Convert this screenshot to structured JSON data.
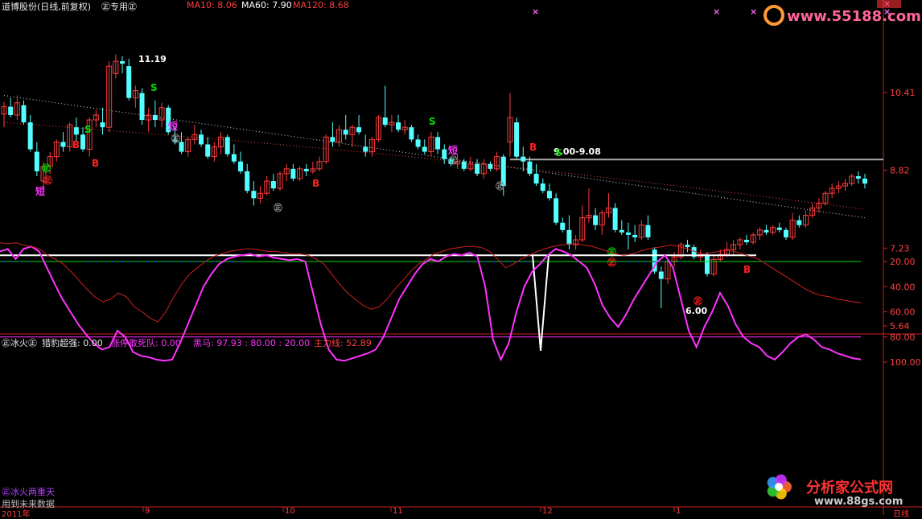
{
  "header": {
    "stock": "道博股份(日线,前复权)",
    "special": "㊣专用㊣",
    "ma10": "MA10: 8.06",
    "ma60": "MA60: 7.90",
    "ma120": "MA120: 8.68"
  },
  "indicator_header": {
    "name": "㊣冰火㊣",
    "leopard": "猎豹超强: 0.00",
    "zhangting": "涨停敢死队: 0.00",
    "heima": "黑马: 97.93 : 80.00 : 20.00",
    "zhuli": "主力线: 52.89"
  },
  "bottom_labels": {
    "title": "㊣冰火两重天",
    "note": "用到未来数据",
    "year": "2011年",
    "right": "日线"
  },
  "watermarks": {
    "top": "www.55188.com",
    "bottom_cn": "分析家公式网",
    "bottom_url": "www.88gs.com"
  },
  "colors": {
    "up": "#ff3c3c",
    "down": "#54ffff",
    "purple": "#b040ff",
    "magenta": "#ff33ff",
    "blue": "#1a1aff",
    "green": "#00dd00",
    "red": "#ff2020",
    "grid": "#8b0000",
    "axis": "#cc2222"
  },
  "chart_data": {
    "type": "candlestick",
    "title": "道博股份(日线,前复权)",
    "price_axis_ticks": [
      "10.41",
      "8.82",
      "7.23",
      "5.64"
    ],
    "price_range": [
      5.64,
      11.2
    ],
    "month_labels": [
      "9",
      "10",
      "11",
      "12",
      "1"
    ],
    "annotations": {
      "high_label": "11.19",
      "low_label": "6.00",
      "range_label": "9.00-9.08",
      "signal_B": "B",
      "signal_S": "S",
      "signal_short": "短",
      "signal_zheng": "㊣"
    },
    "candles": [
      {
        "o": 9.97,
        "h": 10.22,
        "l": 9.7,
        "c": 10.12
      },
      {
        "o": 10.12,
        "h": 10.3,
        "l": 9.9,
        "c": 9.95
      },
      {
        "o": 9.95,
        "h": 10.35,
        "l": 9.85,
        "c": 10.2
      },
      {
        "o": 10.15,
        "h": 10.25,
        "l": 9.75,
        "c": 9.8
      },
      {
        "o": 9.8,
        "h": 9.95,
        "l": 9.2,
        "c": 9.25
      },
      {
        "o": 9.2,
        "h": 9.4,
        "l": 8.7,
        "c": 8.8
      },
      {
        "o": 8.6,
        "h": 9.0,
        "l": 8.4,
        "c": 8.9
      },
      {
        "o": 8.9,
        "h": 9.2,
        "l": 8.75,
        "c": 9.1
      },
      {
        "o": 9.1,
        "h": 9.45,
        "l": 9.0,
        "c": 9.4
      },
      {
        "o": 9.4,
        "h": 9.6,
        "l": 9.2,
        "c": 9.3
      },
      {
        "o": 9.3,
        "h": 9.8,
        "l": 9.2,
        "c": 9.75
      },
      {
        "o": 9.7,
        "h": 9.9,
        "l": 9.4,
        "c": 9.55
      },
      {
        "o": 9.55,
        "h": 9.7,
        "l": 9.2,
        "c": 9.25
      },
      {
        "o": 9.25,
        "h": 9.9,
        "l": 9.1,
        "c": 9.85
      },
      {
        "o": 9.85,
        "h": 10.05,
        "l": 9.7,
        "c": 9.95
      },
      {
        "o": 9.8,
        "h": 10.1,
        "l": 9.55,
        "c": 9.7
      },
      {
        "o": 9.7,
        "h": 11.05,
        "l": 9.6,
        "c": 10.95
      },
      {
        "o": 10.8,
        "h": 11.19,
        "l": 10.7,
        "c": 11.05
      },
      {
        "o": 11.05,
        "h": 11.15,
        "l": 10.8,
        "c": 11.0
      },
      {
        "o": 10.95,
        "h": 11.1,
        "l": 10.25,
        "c": 10.3
      },
      {
        "o": 10.3,
        "h": 10.55,
        "l": 10.1,
        "c": 10.45
      },
      {
        "o": 10.4,
        "h": 10.5,
        "l": 9.75,
        "c": 9.85
      },
      {
        "o": 9.85,
        "h": 10.1,
        "l": 9.6,
        "c": 9.95
      },
      {
        "o": 9.95,
        "h": 10.25,
        "l": 9.7,
        "c": 9.85
      },
      {
        "o": 9.85,
        "h": 10.2,
        "l": 9.7,
        "c": 10.1
      },
      {
        "o": 10.1,
        "h": 10.15,
        "l": 9.55,
        "c": 9.6
      },
      {
        "o": 9.45,
        "h": 9.7,
        "l": 9.35,
        "c": 9.4
      },
      {
        "o": 9.4,
        "h": 9.6,
        "l": 9.15,
        "c": 9.2
      },
      {
        "o": 9.2,
        "h": 9.5,
        "l": 9.1,
        "c": 9.45
      },
      {
        "o": 9.45,
        "h": 9.75,
        "l": 9.35,
        "c": 9.55
      },
      {
        "o": 9.55,
        "h": 9.65,
        "l": 9.3,
        "c": 9.35
      },
      {
        "o": 9.35,
        "h": 9.5,
        "l": 9.05,
        "c": 9.1
      },
      {
        "o": 9.1,
        "h": 9.4,
        "l": 9.0,
        "c": 9.3
      },
      {
        "o": 9.3,
        "h": 9.6,
        "l": 9.15,
        "c": 9.5
      },
      {
        "o": 9.5,
        "h": 9.55,
        "l": 9.1,
        "c": 9.15
      },
      {
        "o": 9.15,
        "h": 9.35,
        "l": 8.95,
        "c": 9.0
      },
      {
        "o": 9.0,
        "h": 9.2,
        "l": 8.75,
        "c": 8.8
      },
      {
        "o": 8.8,
        "h": 8.95,
        "l": 8.35,
        "c": 8.4
      },
      {
        "o": 8.4,
        "h": 8.6,
        "l": 8.1,
        "c": 8.25
      },
      {
        "o": 8.25,
        "h": 8.5,
        "l": 8.15,
        "c": 8.35
      },
      {
        "o": 8.35,
        "h": 8.7,
        "l": 8.3,
        "c": 8.6
      },
      {
        "o": 8.6,
        "h": 8.75,
        "l": 8.4,
        "c": 8.45
      },
      {
        "o": 8.45,
        "h": 8.8,
        "l": 8.4,
        "c": 8.75
      },
      {
        "o": 8.75,
        "h": 8.95,
        "l": 8.6,
        "c": 8.85
      },
      {
        "o": 8.85,
        "h": 8.95,
        "l": 8.6,
        "c": 8.65
      },
      {
        "o": 8.65,
        "h": 8.9,
        "l": 8.6,
        "c": 8.85
      },
      {
        "o": 8.85,
        "h": 8.95,
        "l": 8.7,
        "c": 8.8
      },
      {
        "o": 8.8,
        "h": 9.0,
        "l": 8.75,
        "c": 8.85
      },
      {
        "o": 8.85,
        "h": 9.1,
        "l": 8.8,
        "c": 9.0
      },
      {
        "o": 9.0,
        "h": 9.55,
        "l": 8.95,
        "c": 9.5
      },
      {
        "o": 9.5,
        "h": 9.8,
        "l": 9.3,
        "c": 9.4
      },
      {
        "o": 9.4,
        "h": 9.75,
        "l": 9.3,
        "c": 9.65
      },
      {
        "o": 9.65,
        "h": 9.95,
        "l": 9.45,
        "c": 9.55
      },
      {
        "o": 9.55,
        "h": 9.75,
        "l": 9.3,
        "c": 9.7
      },
      {
        "o": 9.7,
        "h": 9.95,
        "l": 9.55,
        "c": 9.6
      },
      {
        "o": 9.3,
        "h": 9.55,
        "l": 9.1,
        "c": 9.2
      },
      {
        "o": 9.2,
        "h": 9.5,
        "l": 9.1,
        "c": 9.45
      },
      {
        "o": 9.45,
        "h": 9.95,
        "l": 9.4,
        "c": 9.9
      },
      {
        "o": 9.9,
        "h": 10.55,
        "l": 9.7,
        "c": 9.75
      },
      {
        "o": 9.75,
        "h": 9.95,
        "l": 9.6,
        "c": 9.8
      },
      {
        "o": 9.8,
        "h": 9.95,
        "l": 9.6,
        "c": 9.65
      },
      {
        "o": 9.65,
        "h": 9.85,
        "l": 9.55,
        "c": 9.7
      },
      {
        "o": 9.7,
        "h": 9.75,
        "l": 9.4,
        "c": 9.45
      },
      {
        "o": 9.45,
        "h": 9.55,
        "l": 9.25,
        "c": 9.3
      },
      {
        "o": 9.3,
        "h": 9.45,
        "l": 9.15,
        "c": 9.2
      },
      {
        "o": 9.2,
        "h": 9.6,
        "l": 9.1,
        "c": 9.5
      },
      {
        "o": 9.5,
        "h": 9.6,
        "l": 9.15,
        "c": 9.25
      },
      {
        "o": 9.25,
        "h": 9.35,
        "l": 8.95,
        "c": 9.05
      },
      {
        "o": 9.05,
        "h": 9.1,
        "l": 8.9,
        "c": 8.95
      },
      {
        "o": 8.95,
        "h": 9.15,
        "l": 8.85,
        "c": 9.0
      },
      {
        "o": 9.0,
        "h": 9.05,
        "l": 8.8,
        "c": 8.85
      },
      {
        "o": 8.85,
        "h": 9.1,
        "l": 8.8,
        "c": 8.95
      },
      {
        "o": 8.95,
        "h": 9.05,
        "l": 8.7,
        "c": 8.75
      },
      {
        "o": 8.75,
        "h": 9.05,
        "l": 8.65,
        "c": 8.95
      },
      {
        "o": 8.95,
        "h": 9.0,
        "l": 8.8,
        "c": 8.85
      },
      {
        "o": 8.85,
        "h": 9.2,
        "l": 8.8,
        "c": 9.1
      },
      {
        "o": 9.1,
        "h": 9.15,
        "l": 8.3,
        "c": 8.5
      },
      {
        "o": 9.4,
        "h": 10.4,
        "l": 9.1,
        "c": 9.9
      },
      {
        "o": 9.8,
        "h": 9.9,
        "l": 9.05,
        "c": 9.1
      },
      {
        "o": 9.1,
        "h": 9.3,
        "l": 8.8,
        "c": 9.0
      },
      {
        "o": 9.0,
        "h": 9.1,
        "l": 8.7,
        "c": 8.75
      },
      {
        "o": 8.75,
        "h": 8.95,
        "l": 8.5,
        "c": 8.55
      },
      {
        "o": 8.55,
        "h": 8.65,
        "l": 8.35,
        "c": 8.4
      },
      {
        "o": 8.4,
        "h": 8.55,
        "l": 8.2,
        "c": 8.25
      },
      {
        "o": 8.25,
        "h": 8.35,
        "l": 7.7,
        "c": 7.75
      },
      {
        "o": 7.75,
        "h": 7.85,
        "l": 7.55,
        "c": 7.6
      },
      {
        "o": 7.6,
        "h": 7.9,
        "l": 7.2,
        "c": 7.3
      },
      {
        "o": 7.3,
        "h": 7.5,
        "l": 7.2,
        "c": 7.4
      },
      {
        "o": 7.4,
        "h": 8.1,
        "l": 7.35,
        "c": 7.85
      },
      {
        "o": 7.85,
        "h": 8.45,
        "l": 7.75,
        "c": 7.9
      },
      {
        "o": 7.9,
        "h": 8.05,
        "l": 7.6,
        "c": 7.7
      },
      {
        "o": 7.7,
        "h": 8.0,
        "l": 7.5,
        "c": 7.95
      },
      {
        "o": 7.95,
        "h": 8.35,
        "l": 7.85,
        "c": 8.05
      },
      {
        "o": 8.05,
        "h": 8.15,
        "l": 7.55,
        "c": 7.6
      },
      {
        "o": 7.6,
        "h": 7.8,
        "l": 7.5,
        "c": 7.55
      },
      {
        "o": 7.55,
        "h": 7.75,
        "l": 7.2,
        "c": 7.5
      },
      {
        "o": 7.5,
        "h": 7.7,
        "l": 7.35,
        "c": 7.45
      },
      {
        "o": 7.45,
        "h": 7.8,
        "l": 7.4,
        "c": 7.7
      },
      {
        "o": 7.7,
        "h": 7.9,
        "l": 7.4,
        "c": 7.45
      },
      {
        "o": 7.2,
        "h": 7.25,
        "l": 6.7,
        "c": 6.75
      },
      {
        "o": 6.75,
        "h": 6.85,
        "l": 6.0,
        "c": 6.6
      },
      {
        "o": 6.6,
        "h": 7.0,
        "l": 6.5,
        "c": 6.95
      },
      {
        "o": 6.95,
        "h": 7.15,
        "l": 6.85,
        "c": 7.05
      },
      {
        "o": 7.05,
        "h": 7.35,
        "l": 7.0,
        "c": 7.3
      },
      {
        "o": 7.3,
        "h": 7.4,
        "l": 7.15,
        "c": 7.25
      },
      {
        "o": 7.25,
        "h": 7.3,
        "l": 7.0,
        "c": 7.05
      },
      {
        "o": 7.05,
        "h": 7.2,
        "l": 6.95,
        "c": 7.1
      },
      {
        "o": 7.1,
        "h": 7.15,
        "l": 6.65,
        "c": 6.7
      },
      {
        "o": 6.7,
        "h": 7.1,
        "l": 6.65,
        "c": 7.0
      },
      {
        "o": 7.0,
        "h": 7.2,
        "l": 6.95,
        "c": 7.1
      },
      {
        "o": 7.1,
        "h": 7.35,
        "l": 7.05,
        "c": 7.2
      },
      {
        "o": 7.2,
        "h": 7.4,
        "l": 7.1,
        "c": 7.3
      },
      {
        "o": 7.3,
        "h": 7.45,
        "l": 7.2,
        "c": 7.4
      },
      {
        "o": 7.4,
        "h": 7.5,
        "l": 7.3,
        "c": 7.35
      },
      {
        "o": 7.35,
        "h": 7.55,
        "l": 7.3,
        "c": 7.5
      },
      {
        "o": 7.5,
        "h": 7.65,
        "l": 7.4,
        "c": 7.6
      },
      {
        "o": 7.6,
        "h": 7.7,
        "l": 7.5,
        "c": 7.55
      },
      {
        "o": 7.55,
        "h": 7.7,
        "l": 7.5,
        "c": 7.65
      },
      {
        "o": 7.65,
        "h": 7.75,
        "l": 7.55,
        "c": 7.6
      },
      {
        "o": 7.6,
        "h": 7.65,
        "l": 7.4,
        "c": 7.45
      },
      {
        "o": 7.45,
        "h": 7.95,
        "l": 7.4,
        "c": 7.8
      },
      {
        "o": 7.8,
        "h": 7.9,
        "l": 7.65,
        "c": 7.7
      },
      {
        "o": 7.7,
        "h": 8.0,
        "l": 7.65,
        "c": 7.9
      },
      {
        "o": 7.9,
        "h": 8.15,
        "l": 7.85,
        "c": 8.05
      },
      {
        "o": 8.05,
        "h": 8.25,
        "l": 7.95,
        "c": 8.15
      },
      {
        "o": 8.15,
        "h": 8.4,
        "l": 8.1,
        "c": 8.35
      },
      {
        "o": 8.35,
        "h": 8.55,
        "l": 8.25,
        "c": 8.45
      },
      {
        "o": 8.45,
        "h": 8.6,
        "l": 8.35,
        "c": 8.5
      },
      {
        "o": 8.5,
        "h": 8.65,
        "l": 8.4,
        "c": 8.55
      },
      {
        "o": 8.55,
        "h": 8.75,
        "l": 8.5,
        "c": 8.7
      },
      {
        "o": 8.7,
        "h": 8.8,
        "l": 8.55,
        "c": 8.65
      },
      {
        "o": 8.65,
        "h": 8.75,
        "l": 8.45,
        "c": 8.55
      }
    ],
    "indicator": {
      "axis_ticks": [
        "100.00",
        "80.00",
        "60.00",
        "40.00",
        "20.00"
      ],
      "heima_line": [
        12,
        10,
        18,
        10,
        8,
        12,
        25,
        38,
        50,
        60,
        70,
        78,
        85,
        90,
        88,
        75,
        80,
        92,
        95,
        96,
        98,
        99,
        98,
        85,
        70,
        55,
        40,
        30,
        22,
        18,
        16,
        15,
        14,
        16,
        15,
        17,
        18,
        19,
        18,
        20,
        45,
        70,
        90,
        98,
        99,
        97,
        95,
        93,
        90,
        80,
        65,
        50,
        40,
        30,
        22,
        18,
        20,
        16,
        14,
        15,
        13,
        16,
        40,
        82,
        98,
        85,
        60,
        40,
        28,
        22,
        15,
        10,
        12,
        15,
        20,
        25,
        38,
        55,
        65,
        72,
        62,
        50,
        40,
        30,
        20,
        15,
        25,
        50,
        75,
        88,
        72,
        60,
        45,
        55,
        70,
        80,
        85,
        88,
        95,
        98,
        92,
        85,
        80,
        78,
        82,
        88,
        90,
        93,
        95,
        97,
        97.93
      ],
      "zhuli_line": [
        5,
        6,
        5,
        7,
        8,
        10,
        15,
        18,
        22,
        28,
        35,
        42,
        48,
        52,
        50,
        45,
        48,
        56,
        60,
        65,
        68,
        60,
        48,
        38,
        30,
        25,
        20,
        16,
        14,
        12,
        11,
        10,
        10,
        11,
        12,
        12,
        13,
        14,
        14,
        15,
        18,
        22,
        30,
        38,
        45,
        50,
        55,
        58,
        56,
        50,
        42,
        35,
        28,
        22,
        18,
        14,
        12,
        10,
        9,
        8,
        8,
        9,
        12,
        18,
        25,
        22,
        18,
        15,
        12,
        10,
        8,
        7,
        6,
        6,
        7,
        8,
        10,
        12,
        14,
        15,
        14,
        12,
        10,
        9,
        8,
        7,
        8,
        10,
        12,
        14,
        13,
        12,
        11,
        12,
        14,
        16,
        18,
        22,
        26,
        30,
        34,
        38,
        42,
        45,
        47,
        48,
        50,
        51,
        52,
        52.89
      ],
      "blue_bars": [
        [
          0,
          16
        ],
        [
          1,
          10
        ],
        [
          2,
          14
        ],
        [
          3,
          6
        ],
        [
          10,
          18
        ],
        [
          11,
          20
        ],
        [
          12,
          15
        ],
        [
          13,
          10
        ],
        [
          14,
          8
        ],
        [
          15,
          12
        ],
        [
          16,
          18
        ],
        [
          17,
          22
        ],
        [
          18,
          16
        ],
        [
          19,
          14
        ],
        [
          20,
          10
        ],
        [
          21,
          8
        ],
        [
          22,
          6
        ],
        [
          23,
          12
        ],
        [
          24,
          15
        ],
        [
          25,
          18
        ],
        [
          26,
          20
        ],
        [
          27,
          14
        ],
        [
          28,
          10
        ],
        [
          55,
          15
        ],
        [
          56,
          18
        ],
        [
          57,
          20
        ],
        [
          58,
          22
        ],
        [
          59,
          18
        ],
        [
          60,
          14
        ],
        [
          61,
          12
        ],
        [
          62,
          10
        ],
        [
          73,
          12
        ],
        [
          74,
          18
        ],
        [
          75,
          22
        ],
        [
          76,
          25
        ],
        [
          77,
          28
        ],
        [
          78,
          24
        ],
        [
          79,
          20
        ],
        [
          80,
          16
        ],
        [
          90,
          12
        ],
        [
          91,
          10
        ]
      ],
      "magenta_bars_start": 90,
      "magenta_bar_values": [
        80,
        82,
        85,
        88,
        90,
        92,
        95,
        97,
        98,
        92,
        86,
        80,
        82,
        86,
        90,
        93,
        95,
        97,
        97.93
      ],
      "orange_spikes": [
        [
          13,
          70
        ],
        [
          17,
          70
        ]
      ],
      "white_spike_index": 66
    }
  }
}
